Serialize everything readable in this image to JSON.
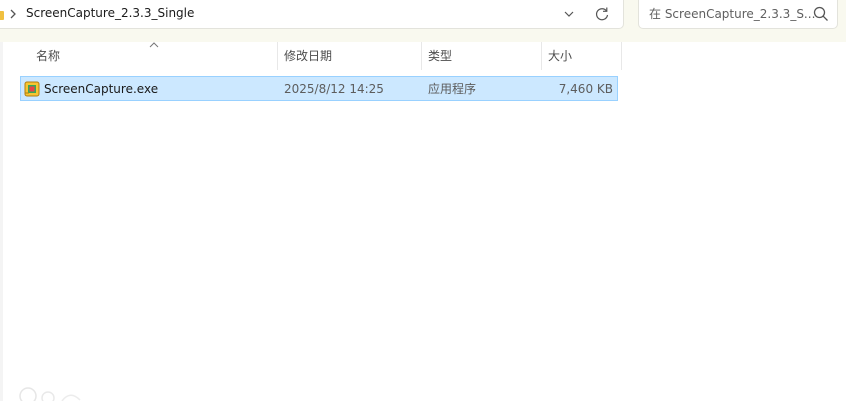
{
  "address_bar": {
    "path_segment": "ScreenCapture_2.3.3_Single"
  },
  "search": {
    "placeholder": "在 ScreenCapture_2.3.3_S..."
  },
  "columns": {
    "name": "名称",
    "date_modified": "修改日期",
    "type": "类型",
    "size": "大小"
  },
  "files": [
    {
      "name": "ScreenCapture.exe",
      "date_modified": "2025/8/12 14:25",
      "type": "应用程序",
      "size": "7,460 KB",
      "selected": true
    }
  ],
  "icons": {
    "folder": "folder-icon",
    "breadcrumb_separator": "chevron-right-icon",
    "history_dropdown": "chevron-down-icon",
    "refresh": "refresh-icon",
    "search": "search-icon",
    "sort": "sort-ascending-icon",
    "file": "application-icon"
  },
  "colors": {
    "selection_fill": "#cce8ff",
    "selection_border": "#99d1ff",
    "toolbar_background": "#f9f9ef"
  }
}
